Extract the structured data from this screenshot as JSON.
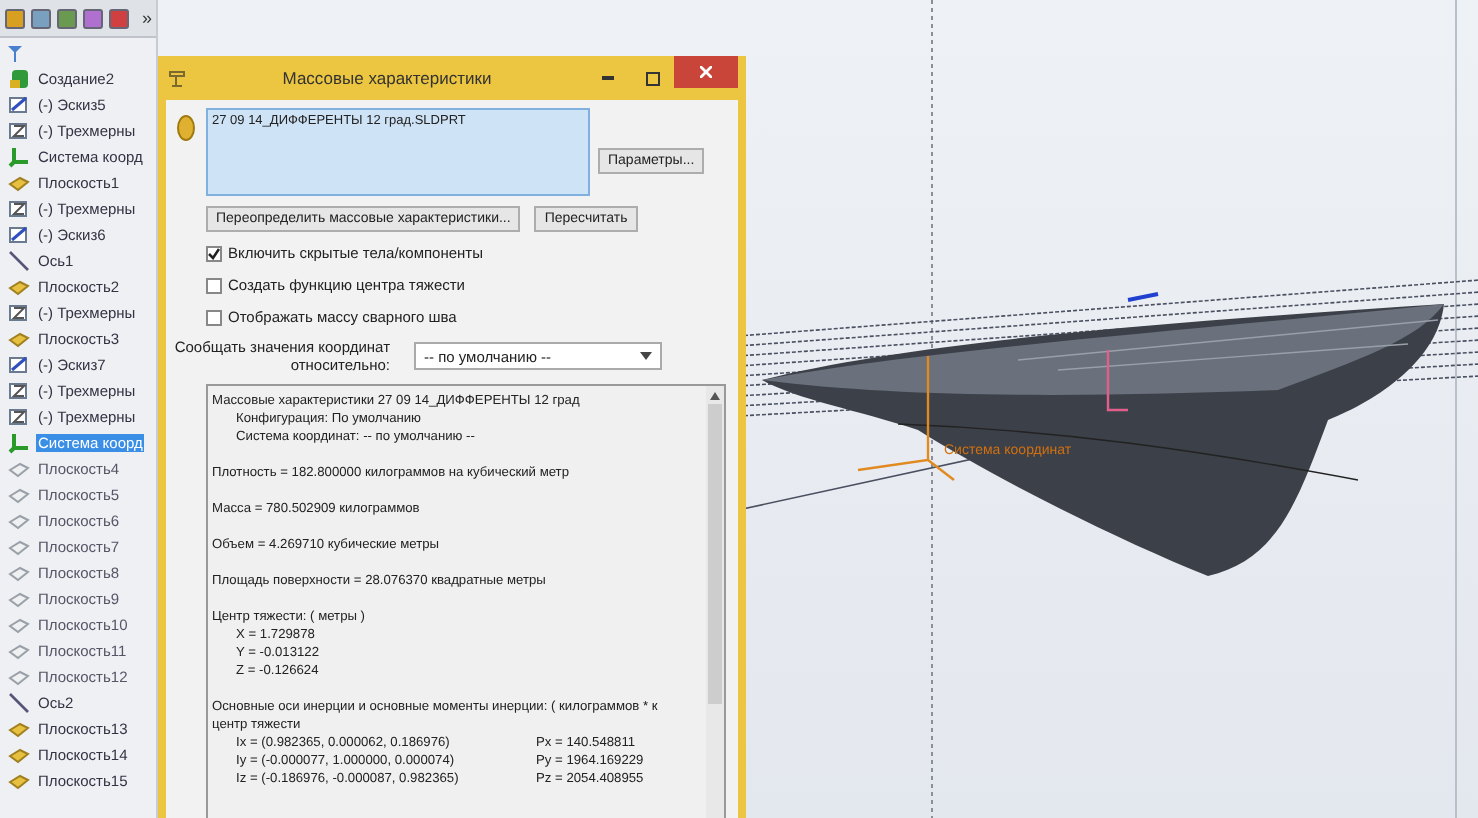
{
  "toolbar": {
    "overflow": "»"
  },
  "tree": {
    "items": [
      {
        "label": "Создание2",
        "kind": "solid",
        "hidden": false,
        "selected": false
      },
      {
        "label": "(-) Эскиз5",
        "kind": "sketch",
        "hidden": false,
        "selected": false
      },
      {
        "label": "(-) Трехмерны",
        "kind": "sketch3d",
        "hidden": false,
        "selected": false
      },
      {
        "label": "Система коорд",
        "kind": "coord",
        "hidden": false,
        "selected": false
      },
      {
        "label": "Плоскость1",
        "kind": "plane",
        "hidden": false,
        "selected": false
      },
      {
        "label": "(-) Трехмерны",
        "kind": "sketch3d",
        "hidden": false,
        "selected": false
      },
      {
        "label": "(-) Эскиз6",
        "kind": "sketch",
        "hidden": false,
        "selected": false
      },
      {
        "label": "Ось1",
        "kind": "axis",
        "hidden": false,
        "selected": false
      },
      {
        "label": "Плоскость2",
        "kind": "plane",
        "hidden": false,
        "selected": false
      },
      {
        "label": "(-) Трехмерны",
        "kind": "sketch3d",
        "hidden": false,
        "selected": false
      },
      {
        "label": "Плоскость3",
        "kind": "plane",
        "hidden": false,
        "selected": false
      },
      {
        "label": "(-) Эскиз7",
        "kind": "sketch",
        "hidden": false,
        "selected": false
      },
      {
        "label": "(-) Трехмерны",
        "kind": "sketch3d",
        "hidden": false,
        "selected": false
      },
      {
        "label": "(-) Трехмерны",
        "kind": "sketch3d",
        "hidden": false,
        "selected": false
      },
      {
        "label": "Система коорд",
        "kind": "coord",
        "hidden": false,
        "selected": true
      },
      {
        "label": "Плоскость4",
        "kind": "plane",
        "hidden": true,
        "selected": false
      },
      {
        "label": "Плоскость5",
        "kind": "plane",
        "hidden": true,
        "selected": false
      },
      {
        "label": "Плоскость6",
        "kind": "plane",
        "hidden": true,
        "selected": false
      },
      {
        "label": "Плоскость7",
        "kind": "plane",
        "hidden": true,
        "selected": false
      },
      {
        "label": "Плоскость8",
        "kind": "plane",
        "hidden": true,
        "selected": false
      },
      {
        "label": "Плоскость9",
        "kind": "plane",
        "hidden": true,
        "selected": false
      },
      {
        "label": "Плоскость10",
        "kind": "plane",
        "hidden": true,
        "selected": false
      },
      {
        "label": "Плоскость11",
        "kind": "plane",
        "hidden": true,
        "selected": false
      },
      {
        "label": "Плоскость12",
        "kind": "plane",
        "hidden": true,
        "selected": false
      },
      {
        "label": "Ось2",
        "kind": "axis",
        "hidden": false,
        "selected": false
      },
      {
        "label": "Плоскость13",
        "kind": "plane",
        "hidden": false,
        "selected": false
      },
      {
        "label": "Плоскость14",
        "kind": "plane",
        "hidden": false,
        "selected": false
      },
      {
        "label": "Плоскость15",
        "kind": "plane",
        "hidden": false,
        "selected": false
      }
    ]
  },
  "dialog": {
    "title": "Массовые характеристики",
    "selection": "27 09 14_ДИФФЕРЕНТЫ 12 град.SLDPRT",
    "options_button": "Параметры...",
    "override_button": "Переопределить массовые характеристики...",
    "recalc_button": "Пересчитать",
    "checkboxes": [
      {
        "label": "Включить скрытые тела/компоненты",
        "checked": true
      },
      {
        "label": "Создать функцию центра тяжести",
        "checked": false
      },
      {
        "label": "Отображать массу сварного шва",
        "checked": false
      }
    ],
    "coord_label": [
      "Сообщать значения координат",
      "относительно:"
    ],
    "coord_select": {
      "value": "-- по умолчанию --"
    },
    "results": {
      "paragraphs": [
        {
          "lines": [
            "Массовые характеристики 27 09 14_ДИФФЕРЕНТЫ 12 град"
          ],
          "children": [
            {
              "text": "Конфигурация: По умолчанию"
            },
            {
              "text": "Система координат: -- по умолчанию --"
            }
          ]
        },
        {
          "lines": [
            "Плотность = 182.800000 килограммов на кубический метр"
          ]
        },
        {
          "lines": [
            "Масса = 780.502909 килограммов"
          ]
        },
        {
          "lines": [
            "Объем = 4.269710 кубические метры"
          ]
        },
        {
          "lines": [
            "Площадь поверхности = 28.076370 квадратные метры"
          ]
        },
        {
          "lines": [
            "Центр тяжести: ( метры )"
          ],
          "children": [
            {
              "text": "X = 1.729878"
            },
            {
              "text": "Y = -0.013122"
            },
            {
              "text": "Z = -0.126624"
            }
          ]
        },
        {
          "lines": [
            "Основные оси инерции и основные моменты инерции: ( килограммов * к",
            "центр тяжести"
          ],
          "children": [
            {
              "text": "Ix = (0.982365, 0.000062, 0.186976)",
              "moment": "Px = 140.548811"
            },
            {
              "text": "Iy = (-0.000077, 1.000000, 0.000074)",
              "moment": "Py = 1964.169229"
            },
            {
              "text": "Iz = (-0.186976, -0.000087, 0.982365)",
              "moment": "Pz = 2054.408955"
            }
          ]
        }
      ]
    }
  },
  "viewport": {
    "coord_label": "Система координат"
  }
}
